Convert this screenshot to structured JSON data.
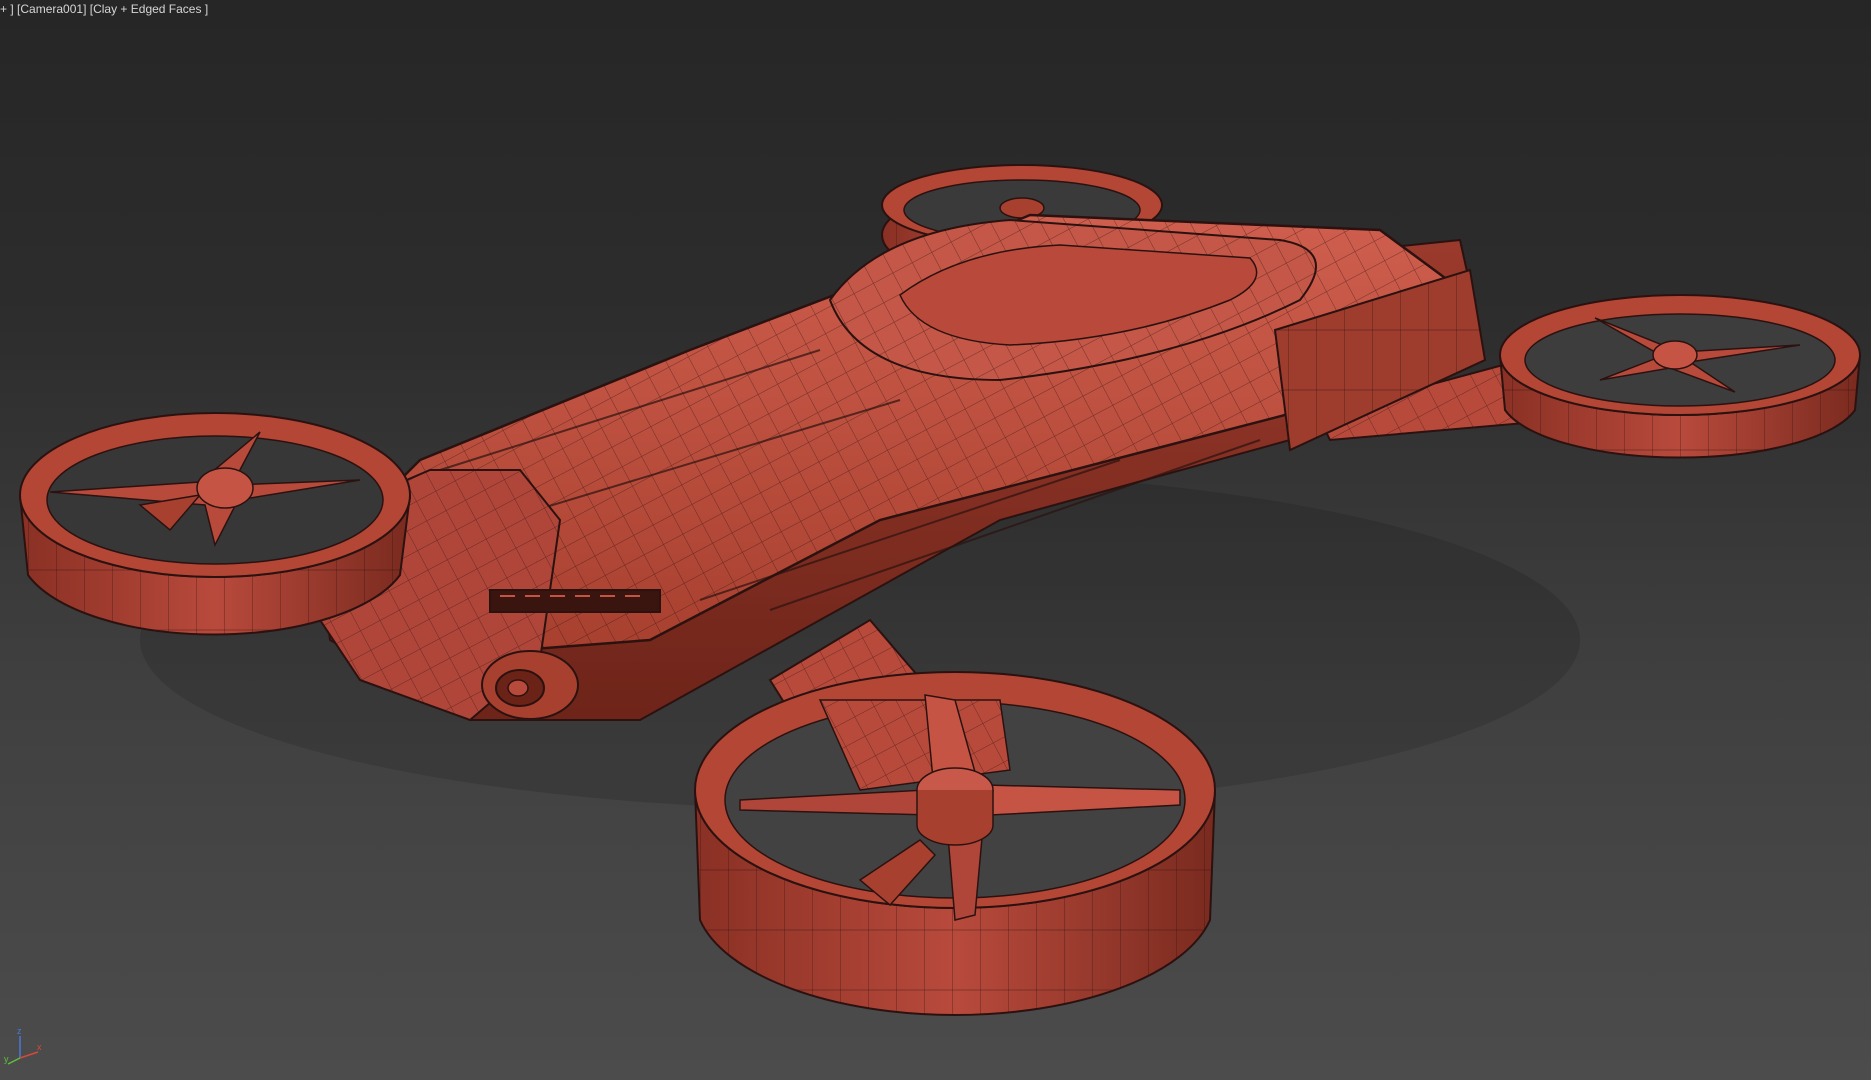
{
  "viewport": {
    "label_parts": [
      "+",
      "Camera001",
      "Clay + Edged Faces"
    ],
    "label_menus": {
      "general": "+",
      "point_of_view": "Camera001",
      "shading": "Clay + Edged Faces"
    }
  },
  "model": {
    "description_icon": "quad-rotor-drone",
    "material_color": "#b84a3c",
    "wire_color": "#2b1210"
  },
  "gizmo": {
    "axis_x": "x",
    "axis_y": "y",
    "axis_z": "z",
    "colors": {
      "x": "#d44a3a",
      "y": "#5fbf3a",
      "z": "#4a78d8"
    }
  },
  "colors": {
    "background_top": "#262626",
    "background_bottom": "#4c4c4c",
    "label_text": "#d6d6d6"
  }
}
